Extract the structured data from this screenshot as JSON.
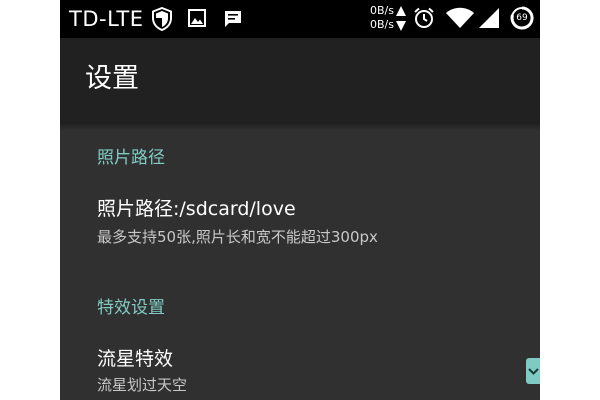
{
  "status_bar": {
    "carrier": "TD-LTE",
    "upload_speed": "0B/s",
    "download_speed": "0B/s",
    "battery_level": "69",
    "icons": [
      "shield-icon",
      "image-icon",
      "message-icon",
      "upload-arrow-icon",
      "download-arrow-icon",
      "alarm-icon",
      "wifi-icon",
      "cell-signal-icon",
      "battery-icon"
    ]
  },
  "app_bar": {
    "title": "设置"
  },
  "sections": [
    {
      "header": "照片路径",
      "prefs": [
        {
          "title": "照片路径:/sdcard/love",
          "summary": "最多支持50张,照片长和宽不能超过300px"
        }
      ]
    },
    {
      "header": "特效设置",
      "prefs": [
        {
          "title": "流星特效",
          "summary": "流星划过天空"
        }
      ]
    }
  ],
  "colors": {
    "accent": "#80cbc4",
    "background": "#303030",
    "app_bar": "#212121",
    "status_bar": "#000000"
  }
}
